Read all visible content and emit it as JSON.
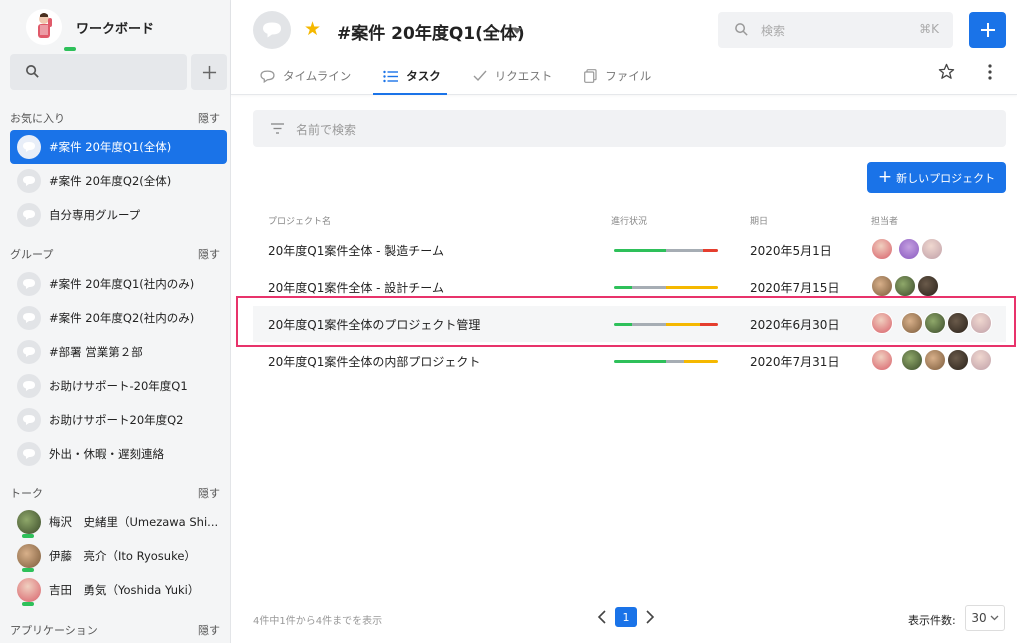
{
  "sidebar": {
    "workspace_name": "ワークボード",
    "favorites_header": "お気に入り",
    "groups_header": "グループ",
    "talk_header": "トーク",
    "apps_header": "アプリケーション",
    "hide_label": "隠す",
    "favorites": [
      {
        "label": "#案件 20年度Q1(全体)"
      },
      {
        "label": "#案件 20年度Q2(全体)"
      },
      {
        "label": "自分専用グループ"
      }
    ],
    "groups": [
      {
        "label": "#案件 20年度Q1(社内のみ)"
      },
      {
        "label": "#案件 20年度Q2(社内のみ)"
      },
      {
        "label": "#部署 営業第２部"
      },
      {
        "label": "お助けサポート-20年度Q1"
      },
      {
        "label": "お助けサポート20年度Q2"
      },
      {
        "label": "外出・休暇・遅刻連絡"
      }
    ],
    "talks": [
      {
        "label": "梅沢　史緒里（Umezawa Shi..."
      },
      {
        "label": "伊藤　亮介（Ito Ryosuke）"
      },
      {
        "label": "吉田　勇気（Yoshida Yuki）"
      }
    ]
  },
  "header": {
    "room_title": "#案件 20年度Q1(全体)",
    "search_placeholder": "検索",
    "search_shortcut": "⌘K",
    "tabs": [
      {
        "label": "タイムライン"
      },
      {
        "label": "タスク"
      },
      {
        "label": "リクエスト"
      },
      {
        "label": "ファイル"
      }
    ]
  },
  "filter_placeholder": "名前で検索",
  "new_project_label": "新しいプロジェクト",
  "table": {
    "columns": [
      "プロジェクト名",
      "進行状況",
      "期日",
      "担当者"
    ],
    "rows": [
      {
        "name": "20年度Q1案件全体 - 製造チーム",
        "date": "2020年5月1日",
        "progress": [
          0.5,
          0.36,
          0.14
        ]
      },
      {
        "name": "20年度Q1案件全体 - 設計チーム",
        "date": "2020年7月15日",
        "progress": [
          0.17,
          0.33,
          0.5
        ]
      },
      {
        "name": "20年度Q1案件全体のプロジェクト管理",
        "date": "2020年6月30日",
        "progress": [
          0.17,
          0.33,
          0.33,
          0.17
        ]
      },
      {
        "name": "20年度Q1案件全体の内部プロジェクト",
        "date": "2020年7月31日",
        "progress": [
          0.5,
          0.17,
          0.33
        ]
      }
    ]
  },
  "footer": {
    "count_text": "4件中1件から4件までを表示",
    "current_page": "1",
    "per_page_label": "表示件数:",
    "per_page_value": "30"
  },
  "colors": {
    "accent": "#1a73e8",
    "green": "#2ec05a",
    "gray": "#a6adb4",
    "yellow": "#f5b800",
    "red": "#e53e2e",
    "highlight": "#e8336b"
  }
}
